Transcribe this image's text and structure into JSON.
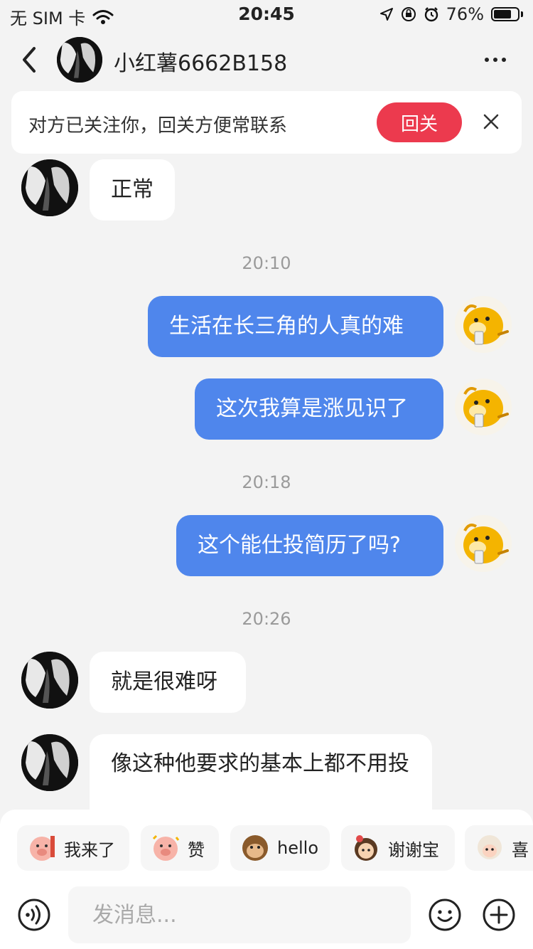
{
  "status_bar": {
    "carrier": "无 SIM 卡",
    "time": "20:45",
    "battery": "76%",
    "battery_level": 0.76
  },
  "header": {
    "name": "小红薯6662B158"
  },
  "banner": {
    "text": "对方已关注你，回关方便常联系",
    "follow_label": "回关"
  },
  "messages": [
    {
      "text": "正常"
    },
    {
      "timestamp": "20:10"
    },
    {
      "text": "生活在长三角的人真的难"
    },
    {
      "text": "这次我算是涨见识了"
    },
    {
      "timestamp": "20:18"
    },
    {
      "text": "这个能仕投简历了吗?"
    },
    {
      "timestamp": "20:26"
    },
    {
      "text": "就是很难呀"
    },
    {
      "text": "像这种他要求的基本上都不用投"
    }
  ],
  "quick_replies": [
    {
      "label": "我来了"
    },
    {
      "label": "赞"
    },
    {
      "label": "hello"
    },
    {
      "label": "谢谢宝"
    },
    {
      "label": "喜"
    }
  ],
  "input": {
    "placeholder": "发消息..."
  },
  "colors": {
    "accent_red": "#ec3a4e",
    "bubble_blue": "#4f86ec",
    "background": "#f3f3f3"
  }
}
